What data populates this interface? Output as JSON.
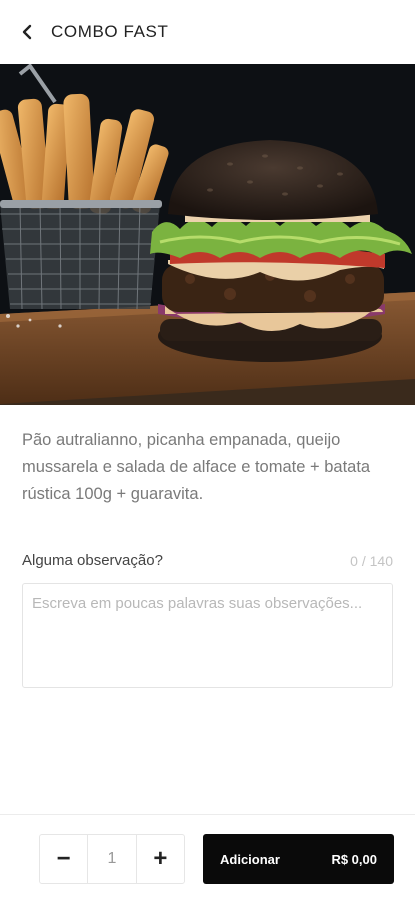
{
  "header": {
    "title": "COMBO FAST",
    "back_icon": "chevron-left-icon"
  },
  "product": {
    "description": "Pão autralianno, picanha empanada, queijo mussarela e salada de alface e tomate + batata rústica 100g + guaravita."
  },
  "observation": {
    "label": "Alguma observação?",
    "counter": "0 / 140",
    "placeholder": "Escreva em poucas palavras suas observações..."
  },
  "footer": {
    "minus": "−",
    "quantity": "1",
    "plus": "+",
    "add_label": "Adicionar",
    "price": "R$ 0,00"
  },
  "colors": {
    "button_bg": "#0a0a0a",
    "description_text": "#7a7a7a"
  }
}
